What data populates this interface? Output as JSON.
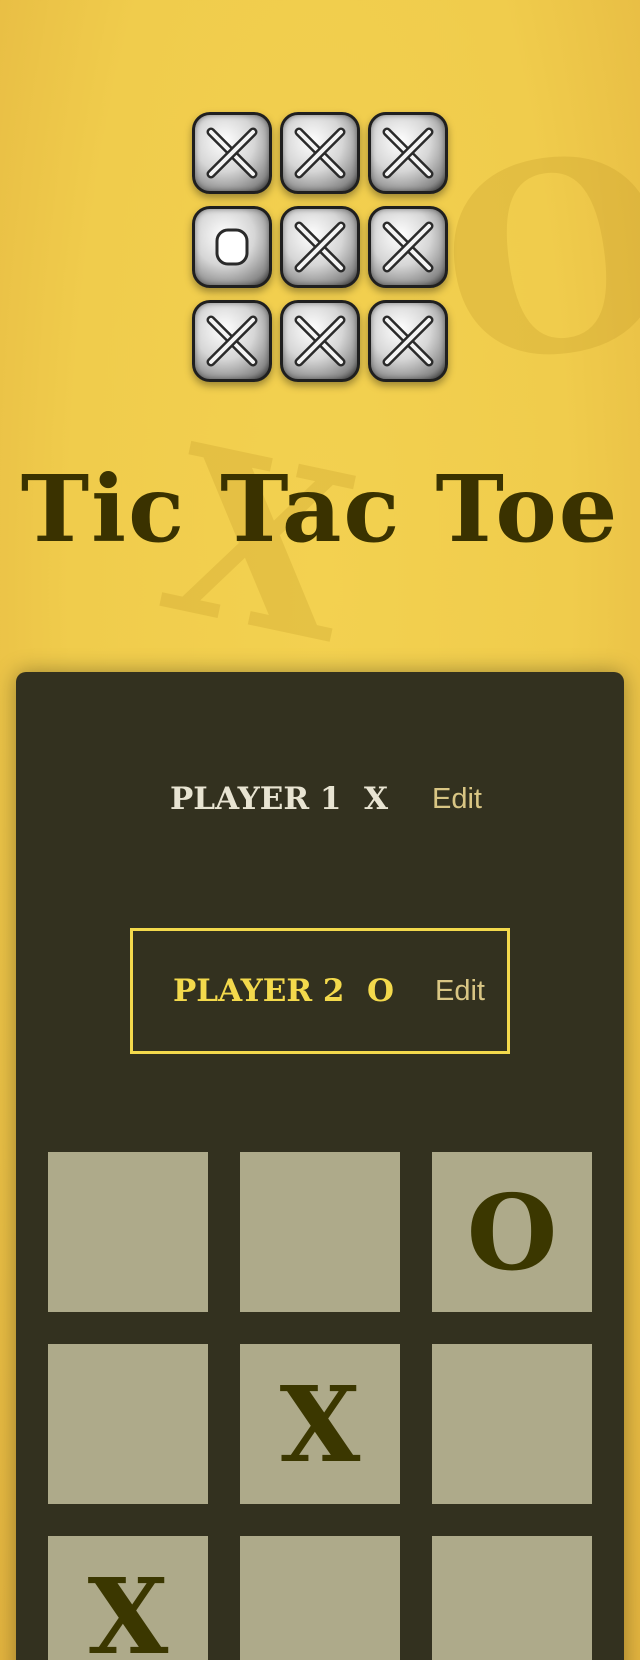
{
  "header": {
    "title": "Tic Tac Toe",
    "logo_tiles": [
      "x",
      "x",
      "x",
      "o",
      "x",
      "x",
      "x",
      "x",
      "x"
    ]
  },
  "players": [
    {
      "name": "PLAYER 1",
      "symbol": "X",
      "edit_label": "Edit",
      "active": false
    },
    {
      "name": "PLAYER 2",
      "symbol": "O",
      "edit_label": "Edit",
      "active": true
    }
  ],
  "board": {
    "cells": [
      "",
      "",
      "O",
      "",
      "X",
      "",
      "X",
      "",
      ""
    ]
  },
  "colors": {
    "background": "#f0cc4c",
    "panel": "#33311f",
    "cell": "#aeaa8a",
    "mark": "#3b3700",
    "active_player": "#f3d94c",
    "edit_link": "#d9c684"
  }
}
